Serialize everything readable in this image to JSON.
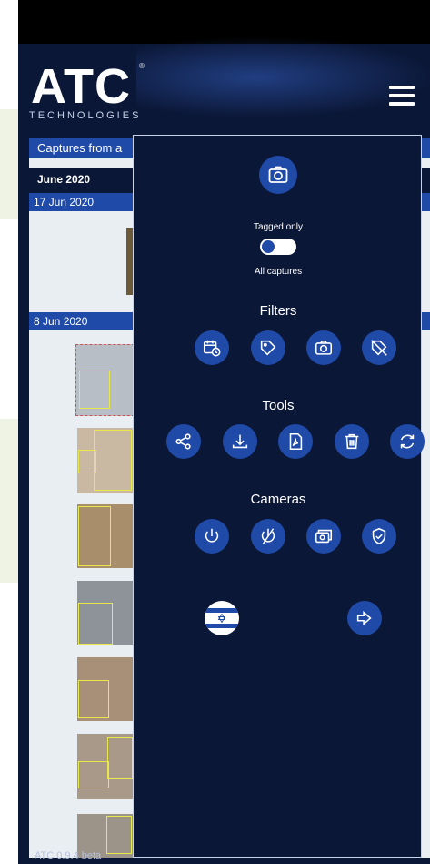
{
  "colors": {
    "background": "#0b1737",
    "accent": "#1f4aa8",
    "topbar": "#000000",
    "menu_border": "#c9d1e6"
  },
  "header": {
    "logo_main": "ATC",
    "logo_registered": "®",
    "logo_sub": "TECHNOLOGIES",
    "menu_icon": "hamburger-icon"
  },
  "gallery": {
    "captures_header": "Captures from a",
    "month": "June 2020",
    "groups": [
      {
        "date": "17 Jun 2020"
      },
      {
        "date": "8 Jun 2020"
      }
    ]
  },
  "menu": {
    "camera_icon": "camera-icon",
    "tagged_only_label": "Tagged only",
    "toggle_state": "off",
    "all_captures_label": "All captures",
    "filters": {
      "title": "Filters",
      "icons": [
        "calendar-clock-icon",
        "tag-icon",
        "camera-icon",
        "tag-remove-icon"
      ]
    },
    "tools": {
      "title": "Tools",
      "icons": [
        "share-icon",
        "download-icon",
        "pdf-icon",
        "trash-icon",
        "refresh-icon"
      ]
    },
    "cameras": {
      "title": "Cameras",
      "icons": [
        "power-icon",
        "power-off-icon",
        "camera-settings-icon",
        "shield-check-icon"
      ]
    },
    "bottom": {
      "language_flag": "israel-flag-icon",
      "logout_icon": "logout-icon"
    }
  },
  "footer": {
    "version": "ATC 0.9.4 beta"
  }
}
